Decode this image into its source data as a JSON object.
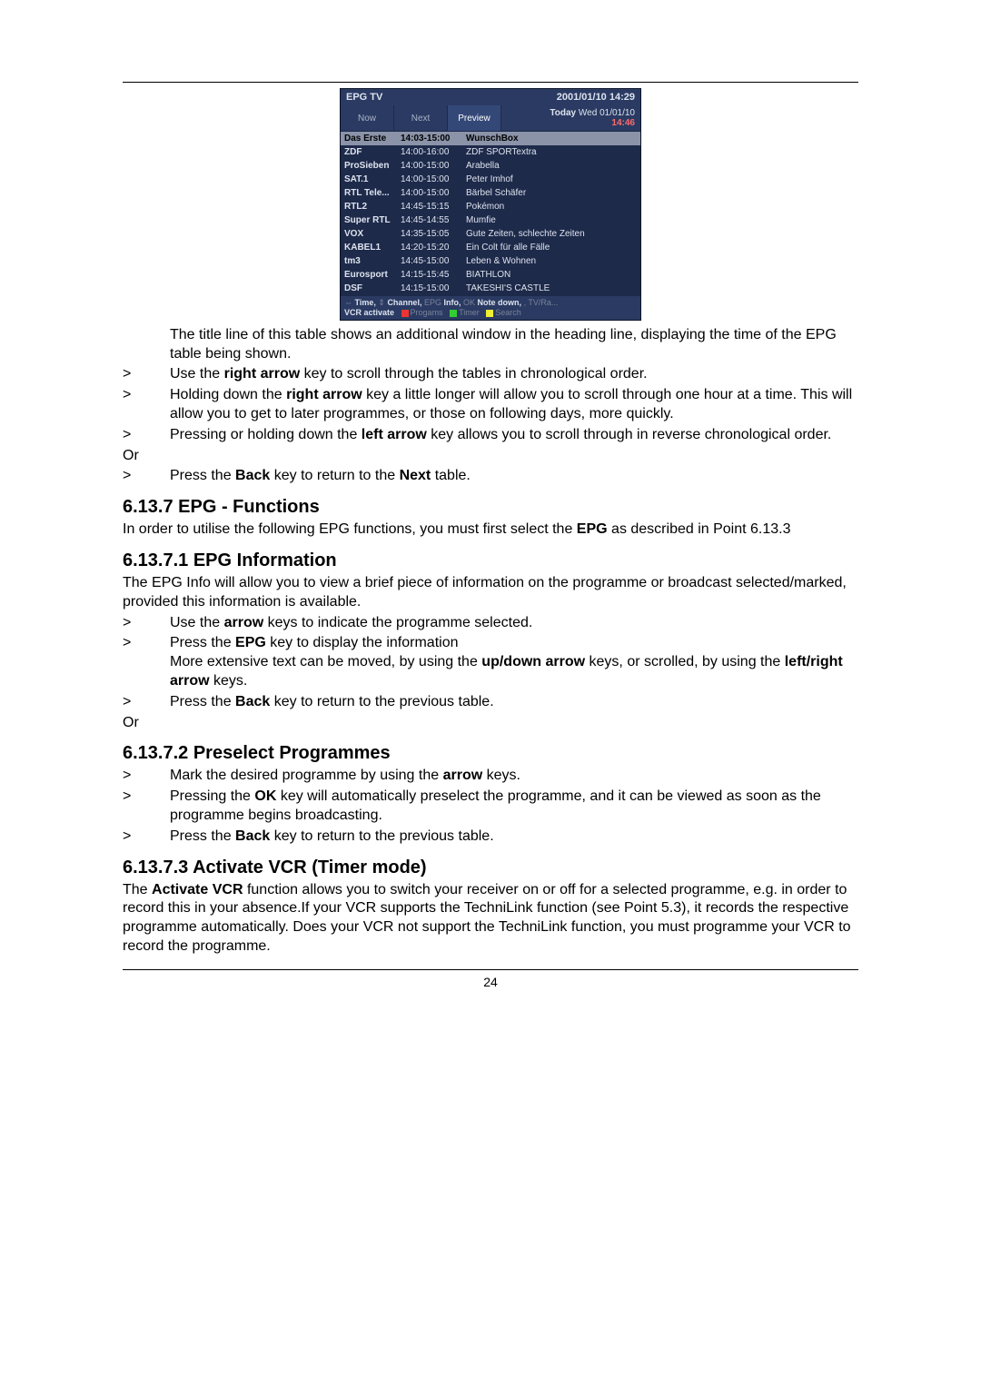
{
  "epg": {
    "title_left": "EPG TV",
    "title_right": "2001/01/10  14:29",
    "tabs": {
      "now": "Now",
      "next": "Next",
      "preview": "Preview"
    },
    "top_right_line1": "Today  Wed 01/01/10",
    "top_right_line2": "14:46",
    "rows": [
      {
        "ch": "Das Erste",
        "time": "14:03-15:00",
        "prog": "WunschBox"
      },
      {
        "ch": "ZDF",
        "time": "14:00-16:00",
        "prog": "ZDF SPORTextra"
      },
      {
        "ch": "ProSieben",
        "time": "14:00-15:00",
        "prog": "Arabella"
      },
      {
        "ch": "SAT.1",
        "time": "14:00-15:00",
        "prog": "Peter Imhof"
      },
      {
        "ch": "RTL Tele...",
        "time": "14:00-15:00",
        "prog": "Bärbel Schäfer"
      },
      {
        "ch": "RTL2",
        "time": "14:45-15:15",
        "prog": "Pokémon"
      },
      {
        "ch": "Super RTL",
        "time": "14:45-14:55",
        "prog": "Mumfie"
      },
      {
        "ch": "VOX",
        "time": "14:35-15:05",
        "prog": "Gute Zeiten, schlechte Zeiten"
      },
      {
        "ch": "KABEL1",
        "time": "14:20-15:20",
        "prog": "Ein Colt für alle Fälle"
      },
      {
        "ch": "tm3",
        "time": "14:45-15:00",
        "prog": "Leben & Wohnen"
      },
      {
        "ch": "Eurosport",
        "time": "14:15-15:45",
        "prog": "BIATHLON"
      },
      {
        "ch": "DSF",
        "time": "14:15-15:00",
        "prog": "TAKESHI'S CASTLE"
      }
    ],
    "footer_line1_a": "Time,",
    "footer_line1_b": "Channel,",
    "footer_line1_c": "Info,",
    "footer_line1_d": "Note down,",
    "footer_line1_e": " , TV/Ra...",
    "footer_vcr": "VCR activate",
    "footer_progams": "Progams",
    "footer_timer": "Timer",
    "footer_search": "Search"
  },
  "body": {
    "para1": "The title line of this table shows an additional window in the heading line, displaying the time of the EPG table being shown.",
    "b1a": "Use the ",
    "b1b": "right arrow",
    "b1c": " key to scroll through the tables in chronological order.",
    "b2a": "Holding down the ",
    "b2b": "right arrow",
    "b2c": " key a little longer will allow you to scroll through one hour at a time. This will allow you to get to later programmes, or those on following days, more quickly.",
    "b3a": "Pressing or holding down the ",
    "b3b": "left arrow",
    "b3c": " key allows you to scroll through in reverse chronological order.",
    "or": "Or",
    "b4a": "Press the ",
    "b4b": "Back",
    "b4c": " key to return to the ",
    "b4d": "Next",
    "b4e": " table.",
    "h6137": "6.13.7 EPG - Functions",
    "p6137a": "In order to utilise the following EPG functions, you must first select the ",
    "p6137b": "EPG",
    "p6137c": " as described in Point 6.13.3",
    "h61371": "6.13.7.1 EPG Information",
    "p61371": "The EPG Info will allow you to view a brief piece of information on the programme or broadcast selected/marked, provided this information is available.",
    "c1a": "Use the ",
    "c1b": "arrow",
    "c1c": " keys to indicate the programme selected.",
    "c2a": "Press the ",
    "c2b": "EPG",
    "c2c": " key to display the information",
    "c3a": "More extensive text can be moved, by using the ",
    "c3b": "up/down arrow",
    "c3c": " keys, or scrolled, by using the ",
    "c3d": "left/right arrow",
    "c3e": " keys.",
    "c4a": "Press the ",
    "c4b": "Back",
    "c4c": " key to return to the previous table.",
    "h61372": "6.13.7.2 Preselect Programmes",
    "d1a": "Mark the desired programme by using the ",
    "d1b": "arrow",
    "d1c": " keys.",
    "d2a": "Pressing the ",
    "d2b": "OK",
    "d2c": " key will automatically preselect the programme, and it can be viewed as soon as the programme begins broadcasting.",
    "d3a": "Press the ",
    "d3b": "Back",
    "d3c": " key to return to the previous table.",
    "h61373": "6.13.7.3 Activate VCR (Timer mode)",
    "p61373a": "The ",
    "p61373b": "Activate VCR",
    "p61373c": " function allows you to switch your receiver on or off for a selected programme, e.g. in order to record this in your absence.If your VCR supports the TechniLink function (see Point 5.3), it records the respective programme automatically. Does your VCR not support the TechniLink function, you must programme your VCR to record the programme.",
    "marker": ">",
    "pagenum": "24"
  }
}
